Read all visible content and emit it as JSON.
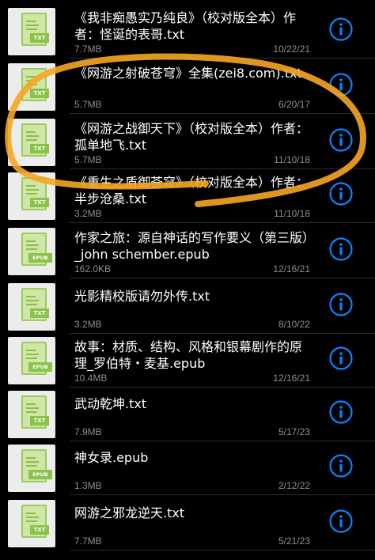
{
  "colors": {
    "background": "#000000",
    "title_text": "#ffffff",
    "meta_text": "#8e8e93",
    "info_accent": "#0a84ff",
    "thumb_bg": "#ececec",
    "doc_green": "#8ac24a",
    "highlighter": "#f5a623"
  },
  "files": [
    {
      "title": "《我非痴愚实乃纯良》（校对版全本）作者：怪诞的表哥.txt",
      "size": "7.7MB",
      "date": "10/22/21",
      "type": "TXT",
      "icon": "txt-file-icon"
    },
    {
      "title": "《网游之射破苍穹》全集(zei8.com).txt",
      "size": "5.7MB",
      "date": "6/20/17",
      "type": "TXT",
      "icon": "txt-file-icon"
    },
    {
      "title": "《网游之战御天下》（校对版全本）作者：孤单地飞.txt",
      "size": "5.7MB",
      "date": "11/10/18",
      "type": "TXT",
      "icon": "txt-file-icon"
    },
    {
      "title": "《重生之盾御苍穹》（校对版全本）作者：半步沧桑.txt",
      "size": "3.2MB",
      "date": "11/10/18",
      "type": "TXT",
      "icon": "txt-file-icon"
    },
    {
      "title": "作家之旅：源自神话的写作要义（第三版）_john schember.epub",
      "size": "162.0KB",
      "date": "12/16/21",
      "type": "EPUB",
      "icon": "epub-file-icon"
    },
    {
      "title": "光影精校版请勿外传.txt",
      "size": "3.2MB",
      "date": "8/10/22",
      "type": "TXT",
      "icon": "txt-file-icon"
    },
    {
      "title": "故事：材质、结构、风格和银幕剧作的原理_罗伯特・麦基.epub",
      "size": "10.4MB",
      "date": "12/16/21",
      "type": "EPUB",
      "icon": "epub-file-icon"
    },
    {
      "title": "武动乾坤.txt",
      "size": "7.9MB",
      "date": "5/17/23",
      "type": "TXT",
      "icon": "txt-file-icon"
    },
    {
      "title": "神女录.epub",
      "size": "1.3MB",
      "date": "2/12/22",
      "type": "EPUB",
      "icon": "epub-file-icon"
    },
    {
      "title": "网游之邪龙逆天.txt",
      "size": "7.7MB",
      "date": "5/21/23",
      "type": "TXT",
      "icon": "txt-file-icon"
    }
  ]
}
